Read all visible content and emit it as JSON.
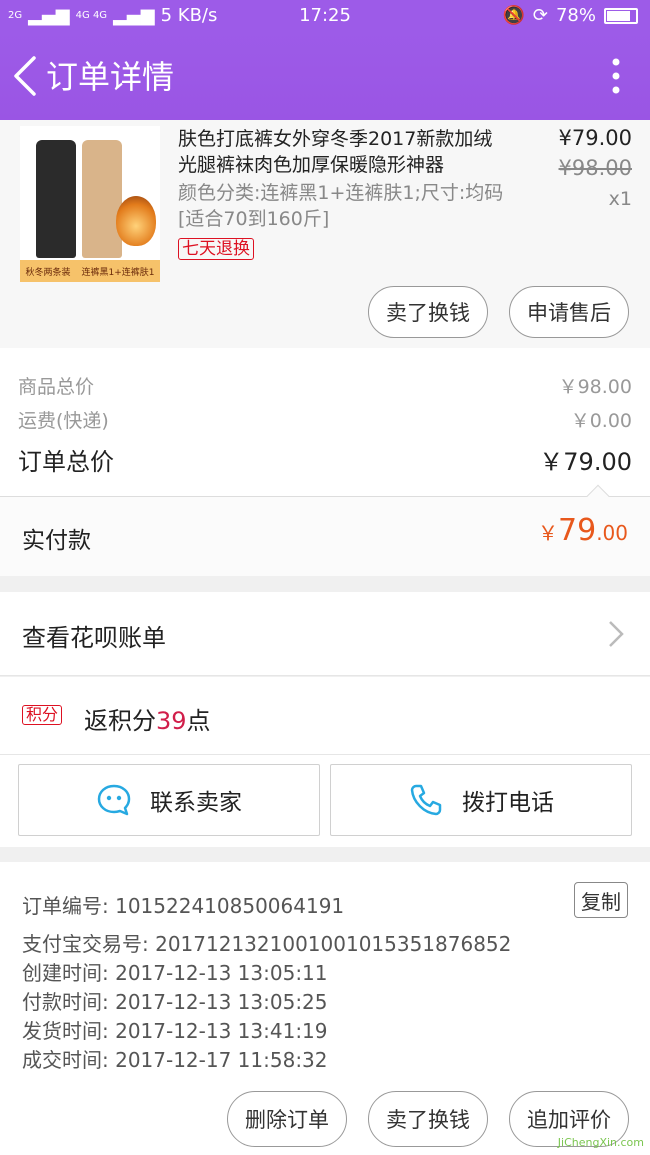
{
  "status_bar": {
    "signal_left": "2G",
    "signal_right": "4G 4G",
    "speed": "5 KB/s",
    "time": "17:25",
    "battery": "78%",
    "battery_level": 0.78
  },
  "app_bar": {
    "title": "订单详情"
  },
  "product": {
    "name": "肤色打底裤女外穿冬季2017新款加绒光腿裤袜肉色加厚保暖隐形神器",
    "spec": "颜色分类:连裤黑1+连裤肤1;尺寸:均码[适合70到160斤]",
    "badge": "七天退换",
    "price": "¥79.00",
    "original_price": "¥98.00",
    "quantity": "x1",
    "thumb_left_label": "秋冬两条装",
    "thumb_right_label": "连裤黑1+连裤肤1",
    "actions": {
      "sell": "卖了换钱",
      "after_sale": "申请售后"
    }
  },
  "summary": {
    "goods_label": "商品总价",
    "goods_value": "￥98.00",
    "shipping_label": "运费(快递)",
    "shipping_value": "￥0.00",
    "total_label": "订单总价",
    "total_value": "￥79.00"
  },
  "payment": {
    "label": "实付款",
    "currency": "￥",
    "integer": "79",
    "decimal": ".00"
  },
  "huabei": {
    "label": "查看花呗账单"
  },
  "points": {
    "tag": "积分",
    "prefix": "返积分",
    "number": "39",
    "suffix": "点"
  },
  "contacts": {
    "seller": "联系卖家",
    "call": "拨打电话"
  },
  "order_info": {
    "order_no": "订单编号: 101522410850064191",
    "copy": "复制",
    "alipay_no": "支付宝交易号: 2017121321001001015351876852",
    "created": "创建时间: 2017-12-13 13:05:11",
    "paid": "付款时间: 2017-12-13 13:05:25",
    "shipped": "发货时间: 2017-12-13 13:41:19",
    "completed": "成交时间: 2017-12-17 11:58:32"
  },
  "footer": {
    "delete": "删除订单",
    "sell": "卖了换钱",
    "review": "追加评价"
  },
  "watermark": "JiChengXin.com",
  "colors": {
    "header": "#9d5be8",
    "accent_orange": "#e8581c",
    "accent_red": "#d11e4a",
    "icon_blue": "#27a9e1"
  }
}
